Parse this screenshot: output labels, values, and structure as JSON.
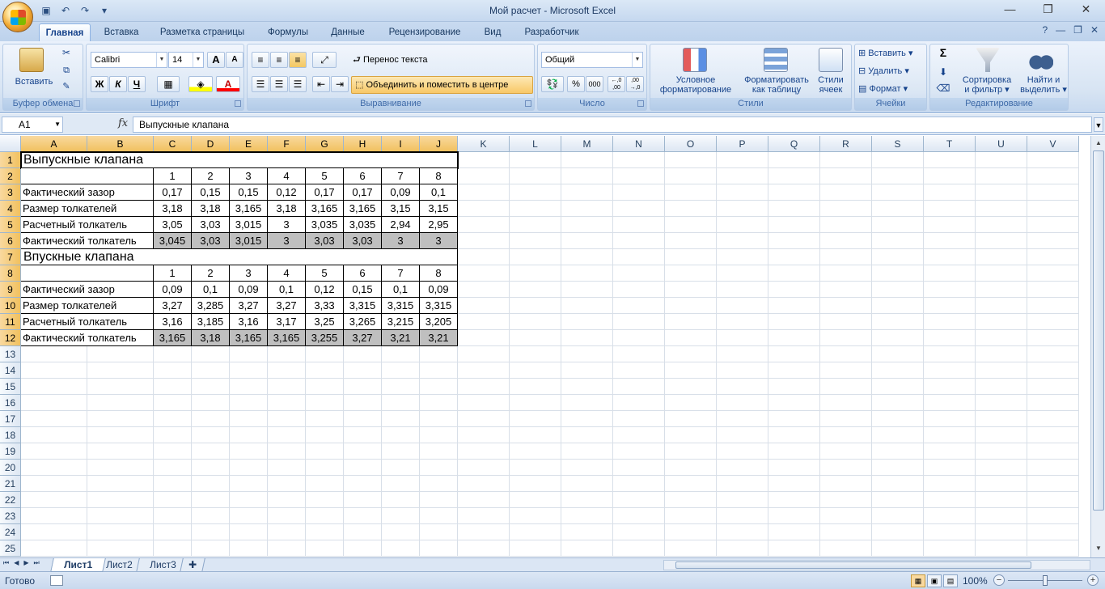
{
  "window": {
    "title": "Мой расчет - Microsoft Excel"
  },
  "quick_access": {
    "save_icon": "save-icon",
    "undo_icon": "undo-icon",
    "redo_icon": "redo-icon"
  },
  "tabs": [
    "Главная",
    "Вставка",
    "Разметка страницы",
    "Формулы",
    "Данные",
    "Рецензирование",
    "Вид",
    "Разработчик"
  ],
  "active_tab": "Главная",
  "ribbon": {
    "clipboard": {
      "label": "Буфер обмена",
      "paste": "Вставить"
    },
    "font": {
      "label": "Шрифт",
      "font_name": "Calibri",
      "font_size": "14",
      "bold": "Ж",
      "italic": "К",
      "underline": "Ч",
      "grow": "A",
      "shrink": "A",
      "font_color_letter": "A"
    },
    "alignment": {
      "label": "Выравнивание",
      "wrap_text": "Перенос текста",
      "merge_center": "Объединить и поместить в центре"
    },
    "number": {
      "label": "Число",
      "format": "Общий",
      "percent": "%",
      "thousands": "000",
      "inc_decimal": "←,0 ,00",
      "dec_decimal": ",00 →,0"
    },
    "styles": {
      "label": "Стили",
      "conditional_line1": "Условное",
      "conditional_line2": "форматирование",
      "table_line1": "Форматировать",
      "table_line2": "как таблицу",
      "cell_line1": "Стили",
      "cell_line2": "ячеек"
    },
    "cells": {
      "label": "Ячейки",
      "insert": "Вставить",
      "delete": "Удалить",
      "format": "Формат"
    },
    "editing": {
      "label": "Редактирование",
      "sort_line1": "Сортировка",
      "sort_line2": "и фильтр",
      "find_line1": "Найти и",
      "find_line2": "выделить",
      "sum": "Σ"
    }
  },
  "formula_bar": {
    "name_box": "A1",
    "fx": "fx",
    "content": "Выпускные клапана"
  },
  "columns": [
    "A",
    "B",
    "C",
    "D",
    "E",
    "F",
    "G",
    "H",
    "I",
    "J",
    "K",
    "L",
    "M",
    "N",
    "O",
    "P",
    "Q",
    "R",
    "S",
    "T",
    "U",
    "V"
  ],
  "rows": [
    "1",
    "2",
    "3",
    "4",
    "5",
    "6",
    "7",
    "8",
    "9",
    "10",
    "11",
    "12",
    "13",
    "14",
    "15",
    "16",
    "17",
    "18",
    "19",
    "20",
    "21",
    "22",
    "23",
    "24",
    "25"
  ],
  "sheet": {
    "title1": "Выпускные клапана",
    "title2": "Впускные клапана",
    "headers": [
      "1",
      "2",
      "3",
      "4",
      "5",
      "6",
      "7",
      "8"
    ],
    "exhaust": [
      {
        "label": "Фактический зазор",
        "values": [
          "0,17",
          "0,15",
          "0,15",
          "0,12",
          "0,17",
          "0,17",
          "0,09",
          "0,1"
        ]
      },
      {
        "label": "Размер толкателей",
        "values": [
          "3,18",
          "3,18",
          "3,165",
          "3,18",
          "3,165",
          "3,165",
          "3,15",
          "3,15"
        ]
      },
      {
        "label": "Расчетный толкатель",
        "values": [
          "3,05",
          "3,03",
          "3,015",
          "3",
          "3,035",
          "3,035",
          "2,94",
          "2,95"
        ]
      },
      {
        "label": "Фактический толкатель",
        "values": [
          "3,045",
          "3,03",
          "3,015",
          "3",
          "3,03",
          "3,03",
          "3",
          "3"
        ]
      }
    ],
    "intake": [
      {
        "label": "Фактический зазор",
        "values": [
          "0,09",
          "0,1",
          "0,09",
          "0,1",
          "0,12",
          "0,15",
          "0,1",
          "0,09"
        ]
      },
      {
        "label": "Размер толкателей",
        "values": [
          "3,27",
          "3,285",
          "3,27",
          "3,27",
          "3,33",
          "3,315",
          "3,315",
          "3,315"
        ]
      },
      {
        "label": "Расчетный толкатель",
        "values": [
          "3,16",
          "3,185",
          "3,16",
          "3,17",
          "3,25",
          "3,265",
          "3,215",
          "3,205"
        ]
      },
      {
        "label": "Фактический толкатель",
        "values": [
          "3,165",
          "3,18",
          "3,165",
          "3,165",
          "3,255",
          "3,27",
          "3,21",
          "3,21"
        ]
      }
    ]
  },
  "sheet_tabs": [
    "Лист1",
    "Лист2",
    "Лист3"
  ],
  "status": {
    "ready": "Готово",
    "zoom": "100%"
  }
}
